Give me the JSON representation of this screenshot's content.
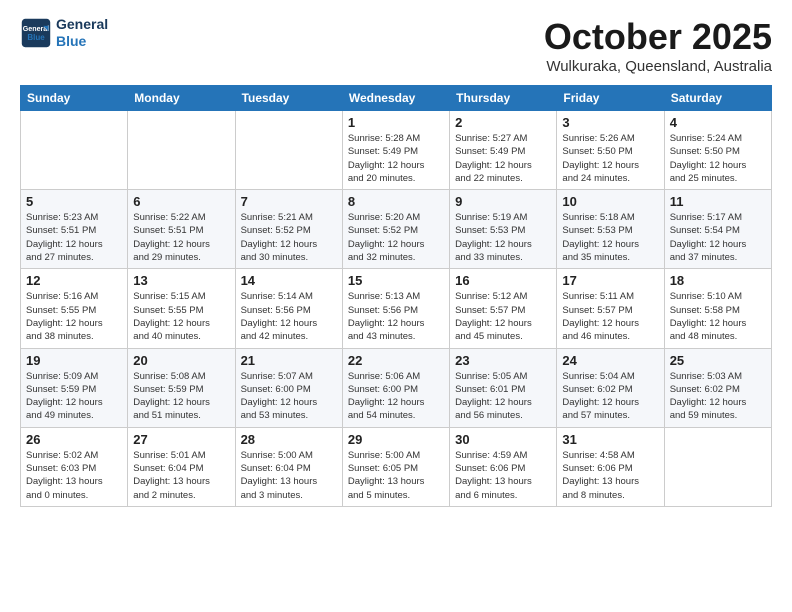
{
  "header": {
    "logo_line1": "General",
    "logo_line2": "Blue",
    "month": "October 2025",
    "location": "Wulkuraka, Queensland, Australia"
  },
  "weekdays": [
    "Sunday",
    "Monday",
    "Tuesday",
    "Wednesday",
    "Thursday",
    "Friday",
    "Saturday"
  ],
  "weeks": [
    [
      {
        "day": "",
        "info": ""
      },
      {
        "day": "",
        "info": ""
      },
      {
        "day": "",
        "info": ""
      },
      {
        "day": "1",
        "info": "Sunrise: 5:28 AM\nSunset: 5:49 PM\nDaylight: 12 hours\nand 20 minutes."
      },
      {
        "day": "2",
        "info": "Sunrise: 5:27 AM\nSunset: 5:49 PM\nDaylight: 12 hours\nand 22 minutes."
      },
      {
        "day": "3",
        "info": "Sunrise: 5:26 AM\nSunset: 5:50 PM\nDaylight: 12 hours\nand 24 minutes."
      },
      {
        "day": "4",
        "info": "Sunrise: 5:24 AM\nSunset: 5:50 PM\nDaylight: 12 hours\nand 25 minutes."
      }
    ],
    [
      {
        "day": "5",
        "info": "Sunrise: 5:23 AM\nSunset: 5:51 PM\nDaylight: 12 hours\nand 27 minutes."
      },
      {
        "day": "6",
        "info": "Sunrise: 5:22 AM\nSunset: 5:51 PM\nDaylight: 12 hours\nand 29 minutes."
      },
      {
        "day": "7",
        "info": "Sunrise: 5:21 AM\nSunset: 5:52 PM\nDaylight: 12 hours\nand 30 minutes."
      },
      {
        "day": "8",
        "info": "Sunrise: 5:20 AM\nSunset: 5:52 PM\nDaylight: 12 hours\nand 32 minutes."
      },
      {
        "day": "9",
        "info": "Sunrise: 5:19 AM\nSunset: 5:53 PM\nDaylight: 12 hours\nand 33 minutes."
      },
      {
        "day": "10",
        "info": "Sunrise: 5:18 AM\nSunset: 5:53 PM\nDaylight: 12 hours\nand 35 minutes."
      },
      {
        "day": "11",
        "info": "Sunrise: 5:17 AM\nSunset: 5:54 PM\nDaylight: 12 hours\nand 37 minutes."
      }
    ],
    [
      {
        "day": "12",
        "info": "Sunrise: 5:16 AM\nSunset: 5:55 PM\nDaylight: 12 hours\nand 38 minutes."
      },
      {
        "day": "13",
        "info": "Sunrise: 5:15 AM\nSunset: 5:55 PM\nDaylight: 12 hours\nand 40 minutes."
      },
      {
        "day": "14",
        "info": "Sunrise: 5:14 AM\nSunset: 5:56 PM\nDaylight: 12 hours\nand 42 minutes."
      },
      {
        "day": "15",
        "info": "Sunrise: 5:13 AM\nSunset: 5:56 PM\nDaylight: 12 hours\nand 43 minutes."
      },
      {
        "day": "16",
        "info": "Sunrise: 5:12 AM\nSunset: 5:57 PM\nDaylight: 12 hours\nand 45 minutes."
      },
      {
        "day": "17",
        "info": "Sunrise: 5:11 AM\nSunset: 5:57 PM\nDaylight: 12 hours\nand 46 minutes."
      },
      {
        "day": "18",
        "info": "Sunrise: 5:10 AM\nSunset: 5:58 PM\nDaylight: 12 hours\nand 48 minutes."
      }
    ],
    [
      {
        "day": "19",
        "info": "Sunrise: 5:09 AM\nSunset: 5:59 PM\nDaylight: 12 hours\nand 49 minutes."
      },
      {
        "day": "20",
        "info": "Sunrise: 5:08 AM\nSunset: 5:59 PM\nDaylight: 12 hours\nand 51 minutes."
      },
      {
        "day": "21",
        "info": "Sunrise: 5:07 AM\nSunset: 6:00 PM\nDaylight: 12 hours\nand 53 minutes."
      },
      {
        "day": "22",
        "info": "Sunrise: 5:06 AM\nSunset: 6:00 PM\nDaylight: 12 hours\nand 54 minutes."
      },
      {
        "day": "23",
        "info": "Sunrise: 5:05 AM\nSunset: 6:01 PM\nDaylight: 12 hours\nand 56 minutes."
      },
      {
        "day": "24",
        "info": "Sunrise: 5:04 AM\nSunset: 6:02 PM\nDaylight: 12 hours\nand 57 minutes."
      },
      {
        "day": "25",
        "info": "Sunrise: 5:03 AM\nSunset: 6:02 PM\nDaylight: 12 hours\nand 59 minutes."
      }
    ],
    [
      {
        "day": "26",
        "info": "Sunrise: 5:02 AM\nSunset: 6:03 PM\nDaylight: 13 hours\nand 0 minutes."
      },
      {
        "day": "27",
        "info": "Sunrise: 5:01 AM\nSunset: 6:04 PM\nDaylight: 13 hours\nand 2 minutes."
      },
      {
        "day": "28",
        "info": "Sunrise: 5:00 AM\nSunset: 6:04 PM\nDaylight: 13 hours\nand 3 minutes."
      },
      {
        "day": "29",
        "info": "Sunrise: 5:00 AM\nSunset: 6:05 PM\nDaylight: 13 hours\nand 5 minutes."
      },
      {
        "day": "30",
        "info": "Sunrise: 4:59 AM\nSunset: 6:06 PM\nDaylight: 13 hours\nand 6 minutes."
      },
      {
        "day": "31",
        "info": "Sunrise: 4:58 AM\nSunset: 6:06 PM\nDaylight: 13 hours\nand 8 minutes."
      },
      {
        "day": "",
        "info": ""
      }
    ]
  ]
}
